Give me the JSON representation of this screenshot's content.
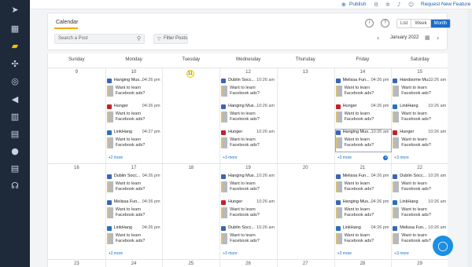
{
  "sidebar": {
    "items": [
      {
        "name": "send-icon",
        "glyph": "➤"
      },
      {
        "name": "dashboard-icon",
        "glyph": "▦"
      },
      {
        "name": "chat-icon",
        "glyph": "▰"
      },
      {
        "name": "network-icon",
        "glyph": "✣"
      },
      {
        "name": "target-icon",
        "glyph": "◎"
      },
      {
        "name": "megaphone-icon",
        "glyph": "◀"
      },
      {
        "name": "analytics-icon",
        "glyph": "▥"
      },
      {
        "name": "inbox-icon",
        "glyph": "▤"
      },
      {
        "name": "users-icon",
        "glyph": "●"
      },
      {
        "name": "reports-icon",
        "glyph": "▤"
      },
      {
        "name": "support-icon",
        "glyph": "☊"
      }
    ]
  },
  "topbar": {
    "publish": "Publish",
    "request": "Request New Feature"
  },
  "header": {
    "tab": "Calendar",
    "search_placeholder": "Search a Post",
    "filter": "Filter Posts",
    "views": [
      "List",
      "Week",
      "Month"
    ],
    "active_view": "Month",
    "month": "January 2022"
  },
  "days": [
    "Sunday",
    "Monday",
    "Tuesday",
    "Wednesday",
    "Thursday",
    "Friday",
    "Saturday"
  ],
  "weeks": [
    {
      "dates": [
        "9",
        "10",
        "11",
        "12",
        "13",
        "14",
        "15"
      ],
      "more": [
        "",
        "+2 more",
        "",
        "+3 more",
        "",
        "+3 more",
        "+3 more"
      ]
    },
    {
      "dates": [
        "16",
        "17",
        "18",
        "19",
        "20",
        "21",
        "22"
      ],
      "more": [
        "",
        "+3 more",
        "",
        "+3 more",
        "",
        "+3 more",
        "+3 more"
      ]
    },
    {
      "dates": [
        "23",
        "24",
        "25",
        "26",
        "27",
        "28",
        "29"
      ],
      "more": [
        "",
        "",
        "",
        "",
        "",
        "",
        ""
      ]
    }
  ],
  "posts_text": "Want to learn Facebook ads?",
  "cells": {
    "w0d1": [
      {
        "name": "Hanging Mus...",
        "time": "04:26 pm",
        "type": "fb"
      },
      {
        "name": "Hunger",
        "time": "04:26 pm",
        "type": "pin"
      },
      {
        "name": "LinkHang",
        "time": "04:27 pm",
        "type": "li"
      }
    ],
    "w0d3": [
      {
        "name": "Dublin Socc...",
        "time": "10:26 am",
        "type": "fb"
      },
      {
        "name": "Hanging Mus...",
        "time": "10:26 am",
        "type": "fb"
      },
      {
        "name": "Hunger",
        "time": "10:26 am",
        "type": "pin"
      }
    ],
    "w0d5": [
      {
        "name": "Melissa Fun...",
        "time": "04:26 pm",
        "type": "fb"
      },
      {
        "name": "Hunger",
        "time": "04:26 pm",
        "type": "pin"
      },
      {
        "name": "Hanging Mus...",
        "time": "10:26 am",
        "type": "fb"
      }
    ],
    "w0d6": [
      {
        "name": "Handsome Mu...",
        "time": "10:26 am",
        "type": "fb"
      },
      {
        "name": "LinkHang",
        "time": "10:26 am",
        "type": "li"
      },
      {
        "name": "Hunger",
        "time": "10:26 am",
        "type": "pin"
      }
    ],
    "w1d1": [
      {
        "name": "Dublin Socc...",
        "time": "04:26 pm",
        "type": "fb"
      },
      {
        "name": "Melissa Fun...",
        "time": "04:26 pm",
        "type": "fb"
      },
      {
        "name": "LinkHang",
        "time": "04:26 pm",
        "type": "li"
      }
    ],
    "w1d3": [
      {
        "name": "Hanging Mus...",
        "time": "10:26 am",
        "type": "fb"
      },
      {
        "name": "Hunger",
        "time": "10:26 am",
        "type": "pin"
      },
      {
        "name": "Dublin Socc...",
        "time": "10:26 am",
        "type": "fb"
      }
    ],
    "w1d5": [
      {
        "name": "Melissa Fun...",
        "time": "04:26 pm",
        "type": "fb"
      },
      {
        "name": "Hanging Mus...",
        "time": "04:26 pm",
        "type": "fb"
      },
      {
        "name": "LinkHang",
        "time": "04:26 pm",
        "type": "li"
      }
    ],
    "w1d6": [
      {
        "name": "Dublin Socc...",
        "time": "10:26 am",
        "type": "fb"
      },
      {
        "name": "LinkHang",
        "time": "10:26 am",
        "type": "li"
      },
      {
        "name": "Melissa Fun...",
        "time": "10:26 am",
        "type": "fb"
      }
    ]
  },
  "colors": {
    "sidebar": "#1e2a3a",
    "accent": "#1a6ec7",
    "highlight": "#f2c200"
  }
}
